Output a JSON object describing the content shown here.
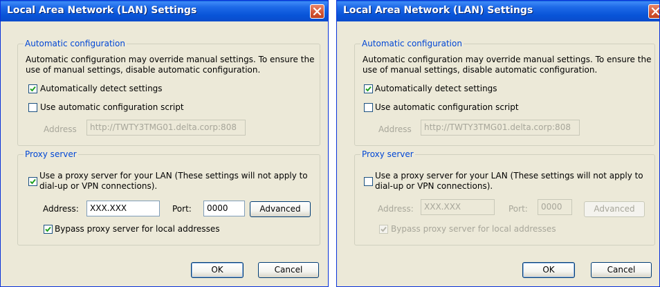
{
  "dialogs": [
    {
      "title": "Local Area Network (LAN) Settings",
      "auto_config": {
        "legend": "Automatic configuration",
        "description_line1": "Automatic configuration may override manual settings.  To ensure the",
        "description_line2": "use of manual settings, disable automatic configuration.",
        "detect_label": "Automatically detect settings",
        "detect_checked": true,
        "script_label": "Use automatic configuration script",
        "script_checked": false,
        "address_label": "Address",
        "address_value": "http://TWTY3TMG01.delta.corp:808"
      },
      "proxy": {
        "legend": "Proxy server",
        "use_proxy_line1": "Use a proxy server for your LAN (These settings will not apply to",
        "use_proxy_line2": "dial-up or VPN connections).",
        "use_proxy_checked": true,
        "address_label": "Address:",
        "address_value": "XXX.XXX",
        "port_label": "Port:",
        "port_value": "0000",
        "advanced_label": "Advanced",
        "bypass_label": "Bypass proxy server for local addresses",
        "bypass_checked": true
      },
      "ok_label": "OK",
      "cancel_label": "Cancel"
    },
    {
      "title": "Local Area Network (LAN) Settings",
      "auto_config": {
        "legend": "Automatic configuration",
        "description_line1": "Automatic configuration may override manual settings.  To ensure the",
        "description_line2": "use of manual settings, disable automatic configuration.",
        "detect_label": "Automatically detect settings",
        "detect_checked": true,
        "script_label": "Use automatic configuration script",
        "script_checked": false,
        "address_label": "Address",
        "address_value": "http://TWTY3TMG01.delta.corp:808"
      },
      "proxy": {
        "legend": "Proxy server",
        "use_proxy_line1": "Use a proxy server for your LAN (These settings will not apply to",
        "use_proxy_line2": "dial-up or VPN connections).",
        "use_proxy_checked": false,
        "address_label": "Address:",
        "address_value": "XXX.XXX",
        "port_label": "Port:",
        "port_value": "0000",
        "advanced_label": "Advanced",
        "bypass_label": "Bypass proxy server for local addresses",
        "bypass_checked": true
      },
      "ok_label": "OK",
      "cancel_label": "Cancel"
    }
  ],
  "colors": {
    "titlebar": "#0a5bda",
    "dialog_bg": "#ece9d8",
    "legend_text": "#0046d5",
    "disabled_text": "#a7a69a",
    "close_button": "#d25433"
  }
}
